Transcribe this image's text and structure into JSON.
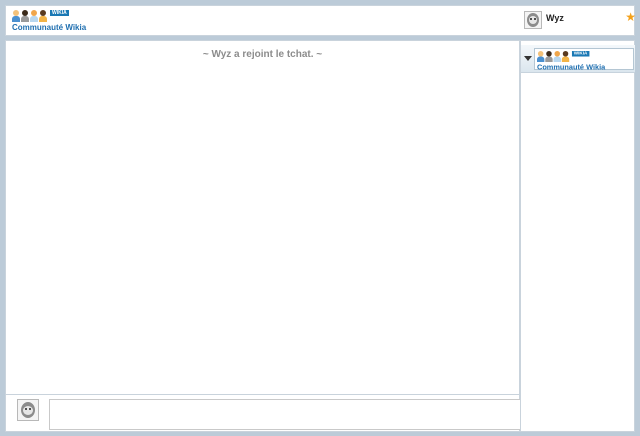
{
  "header": {
    "wiki_logo": {
      "tag": "WIKIA",
      "name": "Communauté Wikia"
    },
    "user": {
      "name": "Wyz",
      "avatar_icon": "owl-avatar-icon",
      "star_icon": "star-icon"
    }
  },
  "chat": {
    "messages": [
      {
        "type": "inline-alert",
        "text": "~ Wyz a rejoint le tchat. ~"
      }
    ]
  },
  "composer": {
    "avatar_icon": "owl-avatar-icon",
    "message_value": "",
    "message_placeholder": ""
  },
  "rail": {
    "room": {
      "tag": "WIKIA",
      "name": "Communauté Wikia",
      "expand_icon": "triangle-down-icon"
    }
  },
  "colors": {
    "page_background": "#bccbd8",
    "brand_blue": "#1f6fb0",
    "star": "#f3a11b",
    "alert_text": "#8c8c8c"
  }
}
